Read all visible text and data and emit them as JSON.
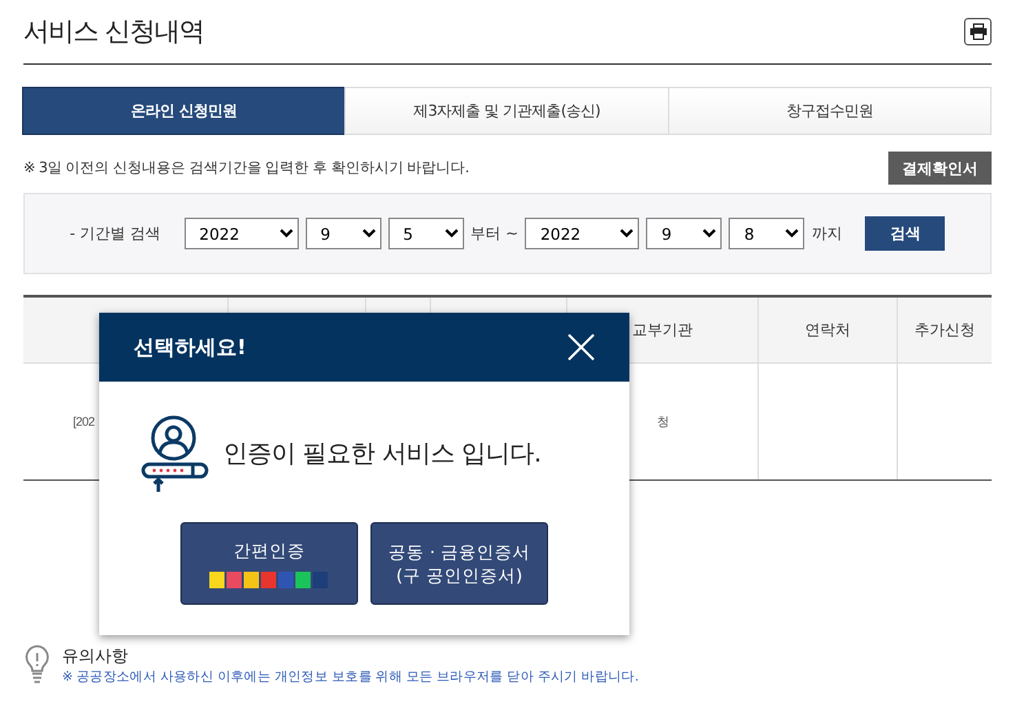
{
  "page": {
    "title": "서비스 신청내역"
  },
  "tabs": [
    {
      "label": "온라인 신청민원",
      "selected": true
    },
    {
      "label": "제3자제출 및 기관제출(송신)",
      "selected": false
    },
    {
      "label": "창구접수민원",
      "selected": false
    }
  ],
  "notice": "※ 3일 이전의 신청내용은 검색기간을 입력한 후 확인하시기 바랍니다.",
  "receipt_button": "결제확인서",
  "search": {
    "label": "- 기간별 검색",
    "from": [
      "2022",
      "9",
      "5"
    ],
    "from_suffix": "부터 ~",
    "to": [
      "2022",
      "9",
      "8"
    ],
    "to_suffix": "까지",
    "button": "검색"
  },
  "table": {
    "columns": [
      "",
      "",
      "",
      "",
      "교부기관",
      "연락처",
      "추가신청"
    ],
    "rows": [
      [
        "[202",
        "",
        "",
        "",
        "청",
        "",
        ""
      ]
    ]
  },
  "modal": {
    "title": "선택하세요!",
    "message": "인증이 필요한 서비스 입니다.",
    "buttons": [
      {
        "kind": "simple",
        "label": "간편인증"
      },
      {
        "kind": "certificate",
        "label": "공동 · 금융인증서",
        "sublabel": "(구 공인인증서)"
      }
    ]
  },
  "caution": {
    "title": "유의사항",
    "text": "※ 공공장소에서 사용하신 이후에는 개인정보 보호를 위해 모든 브라우저를 닫아 주시기 바랍니다."
  }
}
